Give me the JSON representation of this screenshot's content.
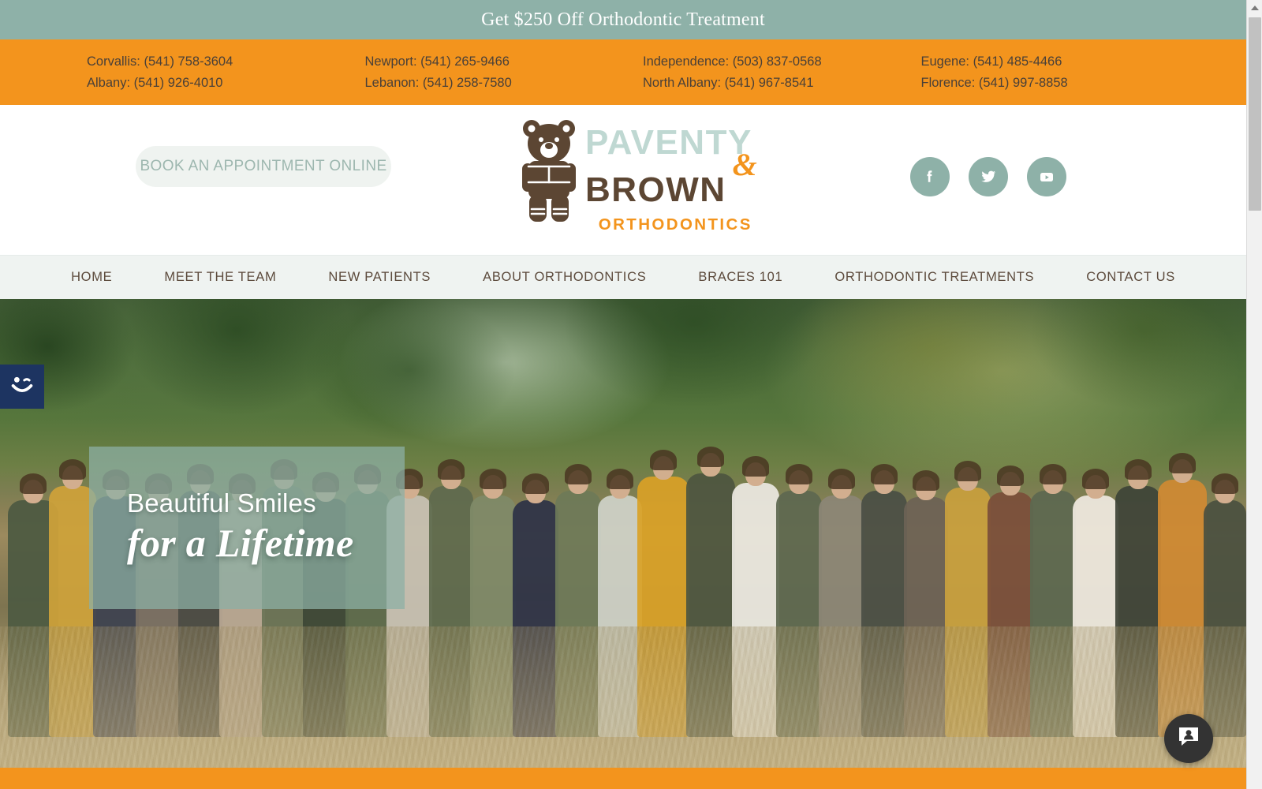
{
  "promo": {
    "text": "Get $250 Off Orthodontic Treatment"
  },
  "colors": {
    "teal": "#8EB1A8",
    "orange": "#F3941D",
    "brown": "#5C4633",
    "nav_bg": "#EFF3F1",
    "logo_light_teal": "#BFD8D2",
    "a11y_navy": "#1D3461",
    "chat_dark": "#333333"
  },
  "phones": {
    "columns": [
      {
        "lines": [
          {
            "city": "Corvallis:",
            "number": "(541) 758-3604"
          },
          {
            "city": "Albany:",
            "number": "(541) 926-4010"
          }
        ]
      },
      {
        "lines": [
          {
            "city": "Newport:",
            "number": "(541) 265-9466"
          },
          {
            "city": "Lebanon:",
            "number": "(541) 258-7580"
          }
        ]
      },
      {
        "lines": [
          {
            "city": "Independence:",
            "number": "(503) 837-0568"
          },
          {
            "city": "North Albany:",
            "number": "(541) 967-8541"
          }
        ]
      },
      {
        "lines": [
          {
            "city": "Eugene:",
            "number": "(541) 485-4466"
          },
          {
            "city": "Florence:",
            "number": "(541) 997-8858"
          }
        ]
      }
    ]
  },
  "header": {
    "book_button_label": "BOOK AN APPOINTMENT ONLINE",
    "logo": {
      "icon": "bear-icon",
      "line1": "PAVENTY",
      "ampersand": "&",
      "line2": "BROWN",
      "line3": "ORTHODONTICS"
    },
    "socials": [
      {
        "name": "facebook-icon",
        "label": "Facebook"
      },
      {
        "name": "twitter-icon",
        "label": "Twitter"
      },
      {
        "name": "youtube-icon",
        "label": "YouTube"
      }
    ]
  },
  "nav": {
    "items": [
      {
        "label": "HOME"
      },
      {
        "label": "MEET THE TEAM"
      },
      {
        "label": "NEW PATIENTS"
      },
      {
        "label": "ABOUT ORTHODONTICS"
      },
      {
        "label": "BRACES 101"
      },
      {
        "label": "ORTHODONTIC TREATMENTS"
      },
      {
        "label": "CONTACT US"
      }
    ]
  },
  "hero": {
    "headline_top": "Beautiful Smiles",
    "headline_bottom": "for a Lifetime",
    "image_alt": "Orthodontics team group photo outdoors"
  },
  "widgets": {
    "accessibility": {
      "icon": "accessibility-smiley-icon",
      "label": "Accessibility options"
    },
    "chat": {
      "icon": "chat-person-icon",
      "label": "Open chat"
    }
  },
  "scrollbar": {
    "up_arrow": "scroll-up-arrow"
  }
}
